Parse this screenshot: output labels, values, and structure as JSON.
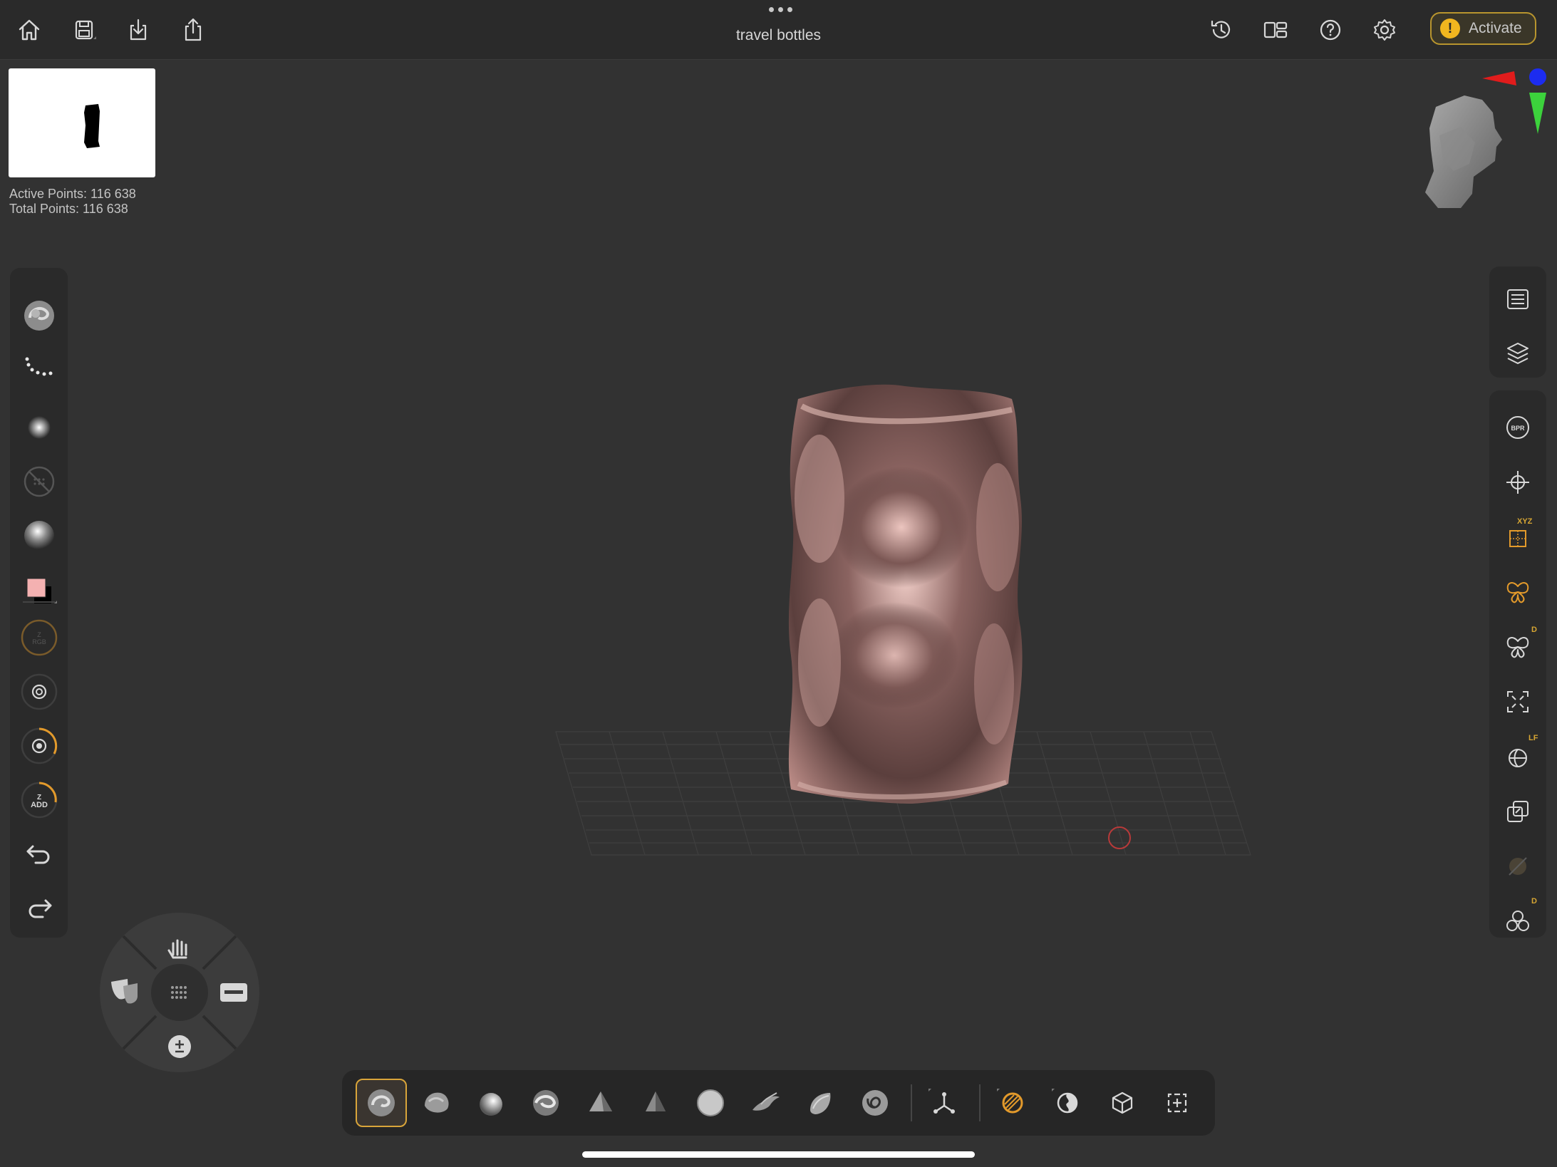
{
  "document": {
    "title": "travel bottles"
  },
  "topbar": {
    "left_icons": [
      "home-icon",
      "save-icon",
      "import-icon",
      "export-icon"
    ],
    "right_icons": [
      "history-icon",
      "layout-icon",
      "help-icon",
      "settings-icon"
    ],
    "activate_label": "Activate",
    "activate_warning_glyph": "!"
  },
  "info": {
    "active_points": "Active Points: 116 638",
    "total_points": "Total Points: 116 638"
  },
  "left_toolbar": {
    "items": [
      "brush-icon",
      "stroke-icon",
      "alpha-icon",
      "texture-icon",
      "material-icon",
      "color-swatch",
      "intensity-dial",
      "draw-size-dial",
      "focal-shift-dial",
      "zadd-toggle",
      "undo-icon",
      "redo-icon"
    ],
    "zadd_line1": "Z",
    "zadd_line2": "ADD",
    "primary_color": "#f4b1b1",
    "secondary_color": "#000000",
    "accent_color": "#e39a2b"
  },
  "right_toolbar": {
    "group_a": [
      "list-icon",
      "layers-icon"
    ],
    "group_b": [
      "bpr-render-icon",
      "gizmo-move-icon",
      "xyz-symmetry-icon",
      "symmetry-icon",
      "dynamic-symmetry-icon",
      "frame-icon",
      "lightbox-icon",
      "transparency-icon",
      "polyframe-icon",
      "solo-icon"
    ],
    "bpr_label": "BPR",
    "xyz_label": "XYZ",
    "d_label": "D",
    "lf_label": "LF",
    "d2_label": "D"
  },
  "bottom_toolbar": {
    "items": [
      {
        "name": "standard-brush",
        "selected": true
      },
      {
        "name": "clay-brush",
        "selected": false
      },
      {
        "name": "inflate-brush",
        "selected": false
      },
      {
        "name": "move-brush",
        "selected": false
      },
      {
        "name": "pinch-brush",
        "selected": false
      },
      {
        "name": "trim-brush",
        "selected": false
      },
      {
        "name": "smooth-brush",
        "selected": false
      },
      {
        "name": "snakehook-brush",
        "selected": false
      },
      {
        "name": "hpolish-brush",
        "selected": false
      },
      {
        "name": "dam-standard-brush",
        "selected": false
      },
      {
        "name": "transpose-icon",
        "selected": false
      },
      {
        "name": "mask-icon",
        "selected": false
      },
      {
        "name": "polish-icon",
        "selected": false
      },
      {
        "name": "polygroup-icon",
        "selected": false
      },
      {
        "name": "select-icon",
        "selected": false
      }
    ]
  },
  "dial": {
    "top": "gesture-icon",
    "left": "mask-theater-icon",
    "right": "keyboard-icon",
    "bottom": "plus-minus-icon",
    "center": "grid-icon"
  },
  "viewport": {
    "mesh_color": "#b98a85",
    "cursor_color": "#b83a3a"
  }
}
